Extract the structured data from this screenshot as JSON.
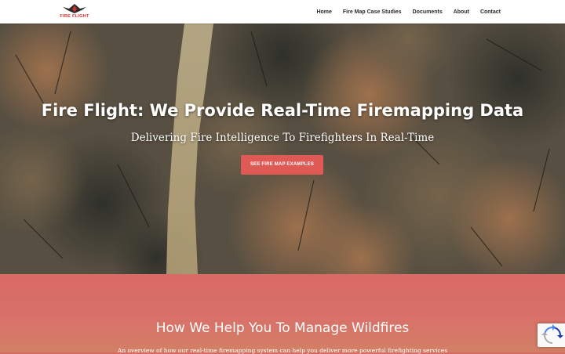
{
  "header": {
    "logo_text": "FIRE FLIGHT",
    "nav": [
      {
        "label": "Home"
      },
      {
        "label": "Fire Map Case Studies"
      },
      {
        "label": "Documents"
      },
      {
        "label": "About"
      },
      {
        "label": "Contact"
      }
    ]
  },
  "hero": {
    "title": "Fire Flight: We Provide Real-Time Firemapping Data",
    "subtitle": "Delivering Fire Intelligence To Firefighters In Real-Time",
    "button_label": "SEE FIRE MAP EXAMPLES"
  },
  "section": {
    "title": "How We Help You To Manage Wildfires",
    "subtitle": "An overview of how our real-time firemapping system can help you deliver more powerful firefighting services"
  },
  "colors": {
    "accent": "#df5a55",
    "section_bg": "#d96a66",
    "logo_red": "#d0312d"
  },
  "icons": {
    "logo": "fire-flight-logo-icon",
    "recaptcha": "recaptcha-icon"
  }
}
